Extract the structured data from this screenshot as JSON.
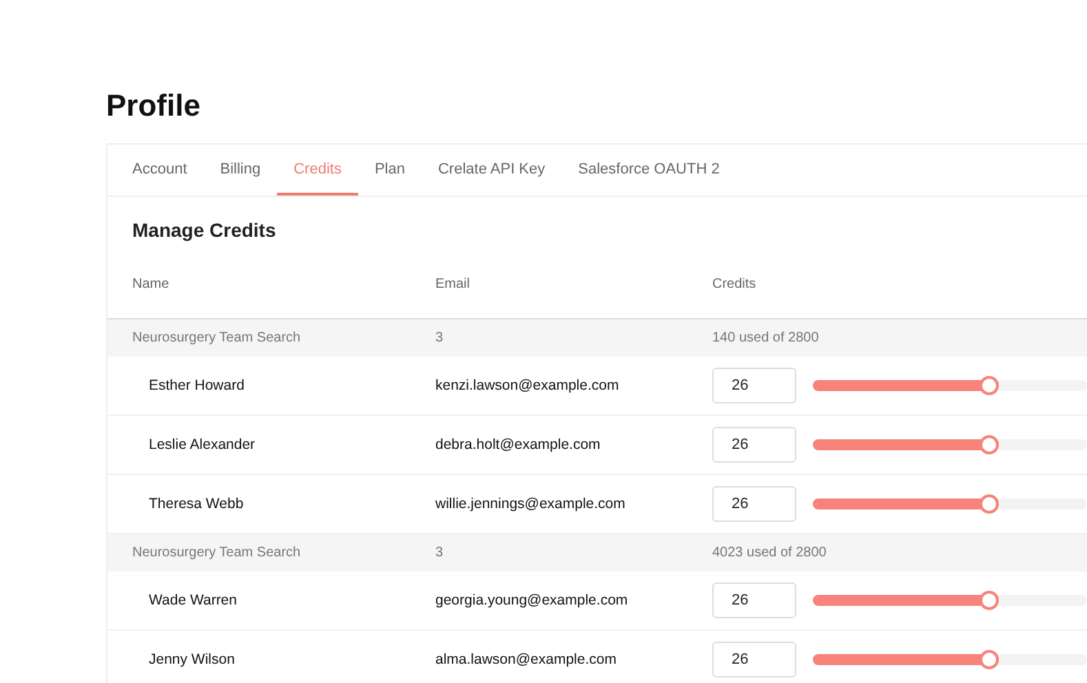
{
  "page_title": "Profile",
  "tabs": [
    {
      "label": "Account",
      "selected": false
    },
    {
      "label": "Billing",
      "selected": false
    },
    {
      "label": "Credits",
      "selected": true
    },
    {
      "label": "Plan",
      "selected": false
    },
    {
      "label": "Crelate API Key",
      "selected": false
    },
    {
      "label": "Salesforce OAUTH 2",
      "selected": false
    }
  ],
  "section_title": "Manage Credits",
  "table": {
    "columns": [
      "Name",
      "Email",
      "Credits"
    ],
    "groups": [
      {
        "name": "Neurosurgery Team Search",
        "count": "3",
        "usage": "140 used of 2800",
        "members": [
          {
            "name": "Esther Howard",
            "email": "kenzi.lawson@example.com",
            "credits": "26",
            "level": 0.64
          },
          {
            "name": "Leslie Alexander",
            "email": "debra.holt@example.com",
            "credits": "26",
            "level": 0.64
          },
          {
            "name": "Theresa Webb",
            "email": "willie.jennings@example.com",
            "credits": "26",
            "level": 0.64
          }
        ]
      },
      {
        "name": "Neurosurgery Team Search",
        "count": "3",
        "usage": "4023 used of 2800",
        "members": [
          {
            "name": "Wade Warren",
            "email": "georgia.young@example.com",
            "credits": "26",
            "level": 0.64
          },
          {
            "name": "Jenny Wilson",
            "email": "alma.lawson@example.com",
            "credits": "26",
            "level": 0.64
          }
        ]
      }
    ]
  }
}
